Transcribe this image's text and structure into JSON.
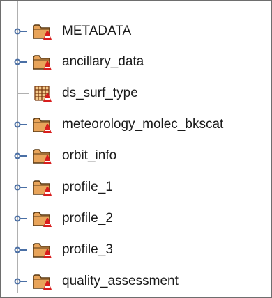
{
  "tree": {
    "nodes": [
      {
        "label": "METADATA",
        "icon": "group-folder-icon",
        "expandable": true
      },
      {
        "label": "ancillary_data",
        "icon": "group-folder-icon",
        "expandable": true
      },
      {
        "label": "ds_surf_type",
        "icon": "dataset-grid-icon",
        "expandable": false
      },
      {
        "label": "meteorology_molec_bkscat",
        "icon": "group-folder-icon",
        "expandable": true
      },
      {
        "label": "orbit_info",
        "icon": "group-folder-icon",
        "expandable": true
      },
      {
        "label": "profile_1",
        "icon": "group-folder-icon",
        "expandable": true
      },
      {
        "label": "profile_2",
        "icon": "group-folder-icon",
        "expandable": true
      },
      {
        "label": "profile_3",
        "icon": "group-folder-icon",
        "expandable": true
      },
      {
        "label": "quality_assessment",
        "icon": "group-folder-icon",
        "expandable": true
      }
    ]
  },
  "colors": {
    "folder": "#e8a45a",
    "folder_border": "#5a3a14",
    "badge": "#d81e1e",
    "toggle": "#4a6fa5",
    "grid_fill": "#f4c98a",
    "grid_lines": "#7a3a10"
  }
}
